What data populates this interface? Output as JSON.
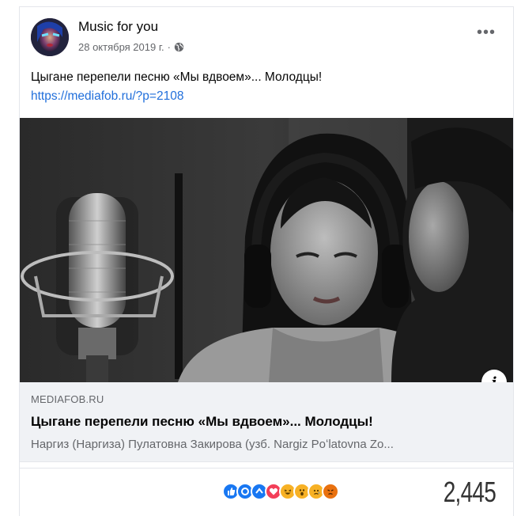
{
  "post": {
    "page_name": "Music for you",
    "date": "28 октября 2019 г.",
    "date_separator": "·",
    "privacy_icon": "globe-icon",
    "more_label": "•••",
    "text": "Цыгане перепели песню «Мы вдвоем»... Молодцы!",
    "link": "https://mediafob.ru/?p=2108"
  },
  "preview": {
    "domain": "MEDIAFOB.RU",
    "title": "Цыгане перепели песню «Мы вдвоем»... Молодцы!",
    "description": "Наргиз (Наргиза) Пулатовна Закирова (узб. Nargiz Poʻlatovna Zo...",
    "info_label": "i"
  },
  "reactions": {
    "icons": [
      "like-icon",
      "like-icon",
      "like-icon",
      "love-icon",
      "haha-icon",
      "wow-icon",
      "sad-icon",
      "angry-icon"
    ],
    "count": "2,445"
  },
  "colors": {
    "like": "#1877f2",
    "love": "#f33e58",
    "emoji": "#f7b125",
    "angry": "#e9710f",
    "link": "#216fdb"
  }
}
